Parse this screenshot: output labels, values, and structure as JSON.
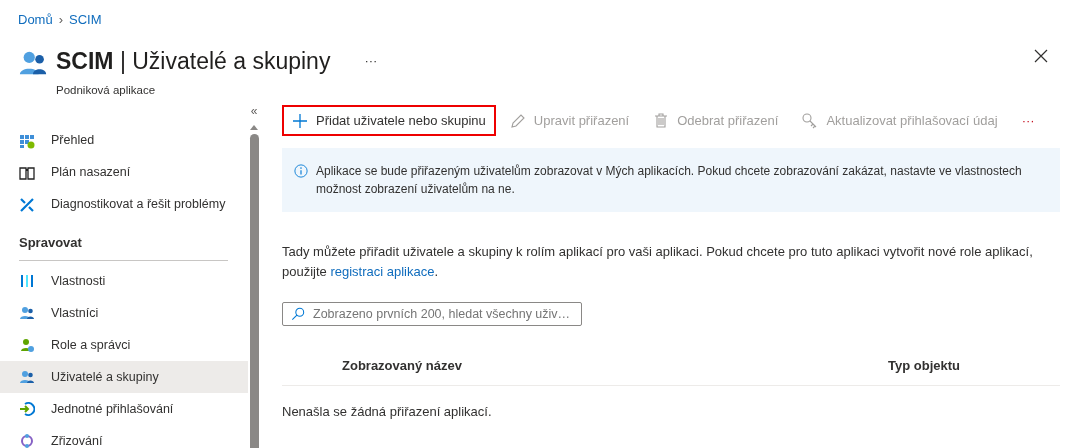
{
  "breadcrumb": {
    "separator": "›",
    "items": [
      {
        "label": "Domů"
      },
      {
        "label": "SCIM"
      }
    ]
  },
  "header": {
    "title": "**SCIM** | Uživatelé a skupiny",
    "subtitle": "Podniková aplikace",
    "more": "···"
  },
  "sidebar": {
    "collapse": "«",
    "items": [
      {
        "kind": "grid",
        "label": "Přehled",
        "selected": false
      },
      {
        "kind": "book",
        "label": "Plán nasazení",
        "selected": false
      },
      {
        "kind": "tools",
        "label": "Diagnostikovat a řešit problémy",
        "selected": false
      },
      {
        "kind": "section",
        "label": "Spravovat"
      },
      {
        "kind": "bars",
        "label": "Vlastnosti",
        "selected": false
      },
      {
        "kind": "users",
        "label": "Vlastníci",
        "selected": false
      },
      {
        "kind": "role",
        "label": "Role a správci",
        "selected": false
      },
      {
        "kind": "users",
        "label": "Uživatelé a skupiny",
        "selected": true
      },
      {
        "kind": "signin",
        "label": "Jednotné přihlašování",
        "selected": false
      },
      {
        "kind": "sync",
        "label": "Zřizování",
        "selected": false
      }
    ]
  },
  "toolbar": [
    {
      "kind": "plus",
      "label": "Přidat uživatele nebo skupinu",
      "disabled": false,
      "highlighted": true
    },
    {
      "kind": "pencil",
      "label": "Upravit přiřazení",
      "disabled": true,
      "highlighted": false
    },
    {
      "kind": "trash",
      "label": "Odebrat přiřazení",
      "disabled": true,
      "highlighted": false
    },
    {
      "kind": "key",
      "label": "Aktualizovat přihlašovací údaj",
      "disabled": true,
      "highlighted": false
    },
    {
      "kind": "more",
      "label": "···",
      "disabled": false,
      "highlighted": false
    }
  ],
  "info": "Aplikace se bude přiřazeným uživatelům zobrazovat v Mých aplikacích. Pokud chcete zobrazování zakázat, nastavte ve vlastnostech možnost zobrazení uživatelům na ne.",
  "description": {
    "text": "Tady můžete přiřadit uživatele a skupiny k rolím aplikací pro vaši aplikaci. Pokud chcete pro tuto aplikaci vytvořit nové role aplikací, použijte",
    "link": "registraci aplikace",
    "after": "."
  },
  "search": {
    "placeholder": "Zobrazeno prvních 200, hledat všechny uživ…"
  },
  "table": {
    "columns": [
      "Zobrazovaný název",
      "Typ objektu"
    ],
    "empty_message": "Nenašla se žádná přiřazení aplikací."
  }
}
